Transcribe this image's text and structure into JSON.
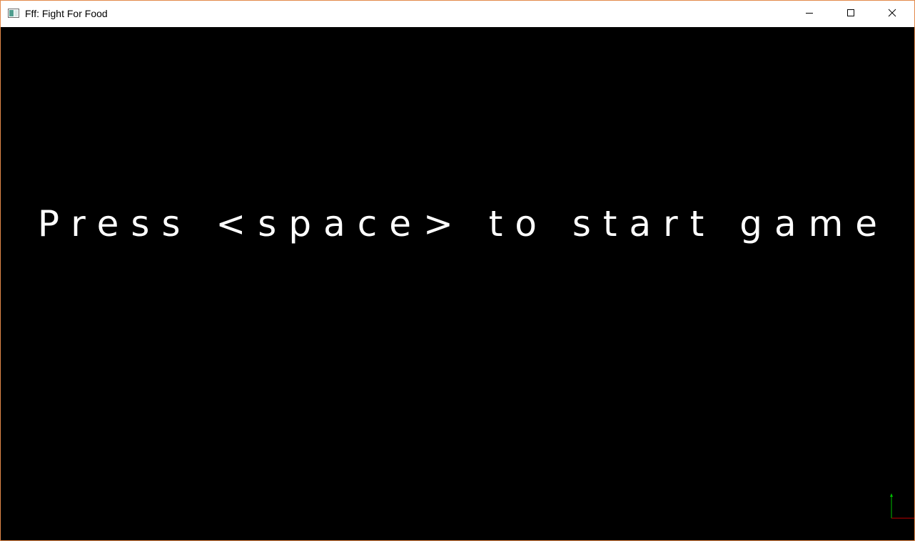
{
  "window": {
    "title": "Fff: Fight For Food",
    "border_color": "#e3894a",
    "controls": {
      "minimize_icon": "minimize-icon",
      "maximize_icon": "maximize-icon",
      "close_icon": "close-icon"
    }
  },
  "game": {
    "background_color": "#000000",
    "prompt_text": "Press <space> to start game",
    "prompt_color": "#ffffff",
    "axis_gizmo": {
      "y_axis_color": "#00c000",
      "x_axis_color": "#c00000"
    }
  }
}
